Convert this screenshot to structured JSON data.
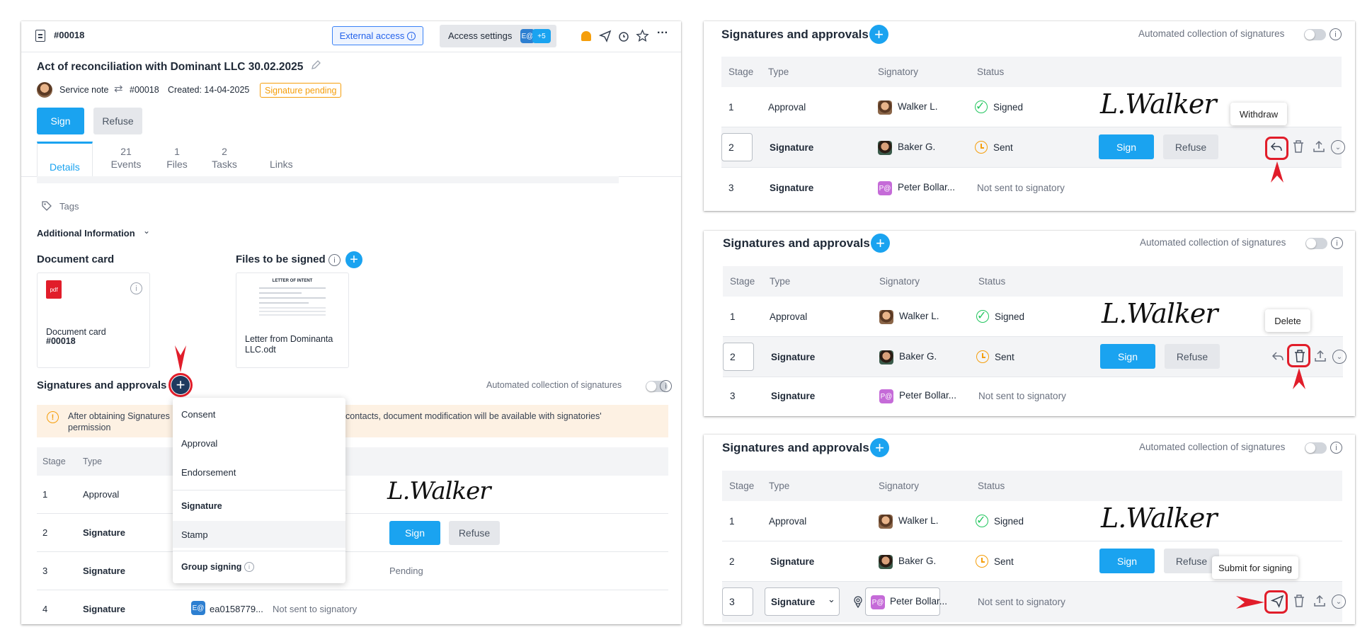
{
  "main": {
    "doc_id": "#00018",
    "external_access": "External access",
    "access_settings": "Access settings",
    "access_avatar": "E@",
    "access_more": "+5",
    "title": "Act of reconciliation with Dominant LLC 30.02.2025",
    "doc_type": "Service note",
    "doc_number": "#00018",
    "created": "Created: 14-04-2025",
    "status": "Signature pending",
    "sign": "Sign",
    "refuse": "Refuse",
    "tabs": [
      {
        "count": "",
        "label": "Details"
      },
      {
        "count": "21",
        "label": "Events"
      },
      {
        "count": "1",
        "label": "Files"
      },
      {
        "count": "2",
        "label": "Tasks"
      },
      {
        "count": "",
        "label": "Links"
      }
    ],
    "tags": "Tags",
    "additional_info": "Additional Information",
    "doc_card_heading": "Document card",
    "doc_card_icon": "pdf",
    "doc_card_label": "Document card",
    "doc_card_number": "#00018",
    "files_heading": "Files to be signed",
    "file_name": "Letter from Dominanta LLC.odt",
    "file_preview_title": "LETTER OF INTENT",
    "sig_heading": "Signatures and approvals",
    "auto_collect": "Automated collection of signatures",
    "warning_left": "After obtaining Signatures",
    "warning_right": "contacts, document modification will be available with signatories'",
    "warning_line2": "permission",
    "columns": {
      "stage": "Stage",
      "type": "Type"
    },
    "rows": [
      {
        "stage": "1",
        "type": "Approval",
        "extra": ""
      },
      {
        "stage": "2",
        "type": "Signature",
        "extra": ""
      },
      {
        "stage": "3",
        "type": "Signature",
        "extra": "Pending"
      },
      {
        "stage": "4",
        "type": "Signature",
        "avatar": "E@",
        "signatory": "ea0158779...",
        "extra": "Not sent to signatory"
      }
    ],
    "signature_image": "L.Walker",
    "menu": [
      "Consent",
      "Approval",
      "Endorsement",
      "Signature",
      "Stamp",
      "Group signing"
    ]
  },
  "panels": [
    {
      "heading": "Signatures and approvals",
      "auto": "Automated collection of signatures",
      "tooltip": "Withdraw"
    },
    {
      "heading": "Signatures and approvals",
      "auto": "Automated collection of signatures",
      "tooltip": "Delete"
    },
    {
      "heading": "Signatures and approvals",
      "auto": "Automated collection of signatures",
      "tooltip": "Submit for signing"
    }
  ],
  "table": {
    "columns": {
      "stage": "Stage",
      "type": "Type",
      "signatory": "Signatory",
      "status": "Status"
    },
    "rows": [
      {
        "stage": "1",
        "type": "Approval",
        "signatory": "Walker L.",
        "status": "Signed"
      },
      {
        "stage": "2",
        "type": "Signature",
        "signatory": "Baker G.",
        "status": "Sent"
      },
      {
        "stage": "3",
        "type": "Signature",
        "avatar": "P@",
        "signatory": "Peter Bollar...",
        "status": "Not sent to signatory"
      }
    ],
    "sign": "Sign",
    "refuse": "Refuse",
    "signature_image": "L.Walker",
    "type_select": "Signature"
  },
  "colors": {
    "accent": "#1aa3f0",
    "status_orange": "#f59e0b",
    "success": "#22c55e",
    "annotation_red": "#e11d2a"
  }
}
